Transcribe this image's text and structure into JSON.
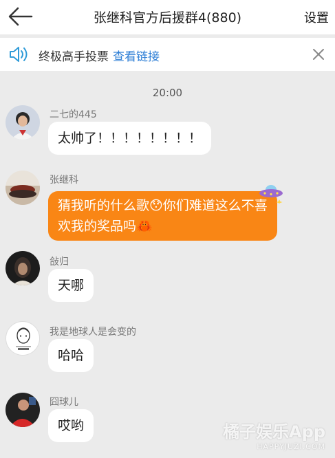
{
  "header": {
    "title": "张继科官方后援群4(880)",
    "settings_label": "设置",
    "back_icon": "back-arrow-icon"
  },
  "notice": {
    "text": "终极高手投票",
    "link": "查看链接",
    "speaker_icon": "speaker-icon",
    "close_icon": "close-icon"
  },
  "timestamp": "20:00",
  "messages": [
    {
      "sender": "二七的445",
      "text": "太帅了！！！！！！！！"
    },
    {
      "sender": "张继科",
      "text": "猜我听的什么歌😯你们难道这么不喜欢我的奖品吗🦀"
    },
    {
      "sender": "敆归",
      "text": "天哪"
    },
    {
      "sender": "我是地球人是会变的",
      "text": "哈哈"
    },
    {
      "sender": "囧球儿",
      "text": "哎哟"
    }
  ],
  "watermark": {
    "main": "橘子娱乐App",
    "sub": "HAPPYJUZI.COM"
  },
  "colors": {
    "accent_link": "#2f7fd6",
    "highlight_bubble": "#f98615",
    "background": "#ebebeb"
  }
}
